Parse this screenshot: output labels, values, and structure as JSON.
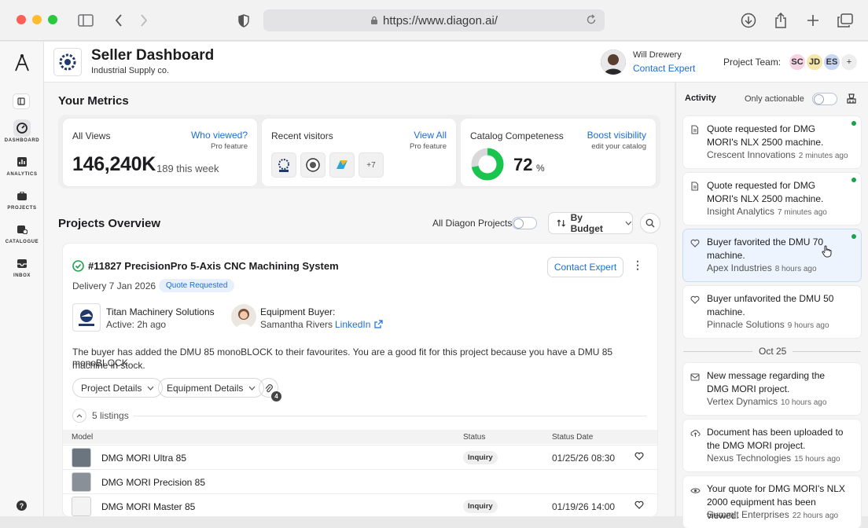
{
  "browser": {
    "url": "https://www.diagon.ai/"
  },
  "header": {
    "title": "Seller Dashboard",
    "subtitle": "Industrial Supply co.",
    "expert_name": "Will Drewery",
    "expert_link": "Contact Expert",
    "team_label": "Project Team:",
    "team": [
      {
        "initials": "SC",
        "color": "#f6d4e3"
      },
      {
        "initials": "JD",
        "color": "#f7e7a8"
      },
      {
        "initials": "ES",
        "color": "#c9d6f5"
      },
      {
        "initials": "+",
        "color": "#eeeeef"
      }
    ]
  },
  "rail": {
    "items": [
      {
        "label": "DASHBOARD",
        "icon": "dashboard-icon"
      },
      {
        "label": "ANALYTICS",
        "icon": "analytics-icon"
      },
      {
        "label": "PROJECTS",
        "icon": "projects-icon"
      },
      {
        "label": "CATALOGUE",
        "icon": "catalogue-icon"
      },
      {
        "label": "INBOX",
        "icon": "inbox-icon"
      }
    ]
  },
  "metrics": {
    "heading": "Your Metrics",
    "views": {
      "label": "All Views",
      "value": "146,240K",
      "sub": "189 this week",
      "link": "Who viewed?",
      "note": "Pro feature"
    },
    "visitors": {
      "label": "Recent  visitors",
      "link": "View All",
      "note": "Pro feature",
      "more": "+7"
    },
    "catalog": {
      "label": "Catalog Competeness",
      "value": "72",
      "unit": "%",
      "percent": 72,
      "link": "Boost visibility",
      "note": "edit your catalog"
    }
  },
  "projects": {
    "heading": "Projects Overview",
    "filter_label": "All Diagon Projects",
    "sort_label": "By Budget",
    "card": {
      "title": "#11827 PrecisionPro 5-Axis CNC Machining System",
      "delivery": "Delivery 7 Jan 2026",
      "status": "Quote Requested",
      "contact": "Contact Expert",
      "company": "Titan Machinery Solutions",
      "company_active": "Active: 2h ago",
      "buyer_label": "Equipment Buyer:",
      "buyer_name": "Samantha Rivers",
      "buyer_link": "LinkedIn",
      "desc1": "The buyer has added the DMU 85 monoBLOCK to their favourites. You are a good fit for this project because you have a DMU 85 monoBLOCK",
      "desc2": "machine in stock.",
      "pill1": "Project Details",
      "pill2": "Equipment Details",
      "attach_count": "4",
      "listings": "5 listings",
      "columns": [
        "Model",
        "Status",
        "Status Date"
      ],
      "rows": [
        {
          "model": "DMG MORI Ultra 85",
          "status": "Inquiry",
          "date": "01/25/26 08:30"
        },
        {
          "model": "DMG MORI Precision 85",
          "status": "",
          "date": ""
        },
        {
          "model": "DMG MORI Master 85",
          "status": "Inquiry",
          "date": "01/19/26 14:00"
        }
      ]
    }
  },
  "activity": {
    "heading": "Activity",
    "toggle_label": "Only actionable",
    "divider": "Oct 25",
    "items": [
      {
        "text": "Quote requested for DMG MORI's NLX 2500 machine.",
        "source": "Crescent Innovations",
        "time": "2 minutes ago",
        "icon": "document-icon"
      },
      {
        "text": "Quote requested for DMG MORI's NLX 2500 machine.",
        "source": "Insight Analytics",
        "time": "7 minutes ago",
        "icon": "document-icon"
      },
      {
        "text": "Buyer favorited the DMU 70 machine.",
        "source": "Apex Industries",
        "time": "8 hours ago",
        "icon": "heart-icon"
      },
      {
        "text": "Buyer unfavorited the DMU 50 machine.",
        "source": "Pinnacle Solutions",
        "time": "9 hours ago",
        "icon": "heart-icon"
      },
      {
        "text": "New message regarding the DMG MORI project.",
        "source": "Vertex Dynamics",
        "time": "10 hours ago",
        "icon": "mail-icon"
      },
      {
        "text": "Document has been uploaded to the DMG MORI project.",
        "source": "Nexus Technologies",
        "time": "15 hours ago",
        "icon": "upload-icon"
      },
      {
        "text": "Your quote for DMG MORI's NLX 2000 equipment has been viewed.",
        "source": "Summit Enterprises",
        "time": "22 hours ago",
        "icon": "eye-icon"
      }
    ]
  }
}
